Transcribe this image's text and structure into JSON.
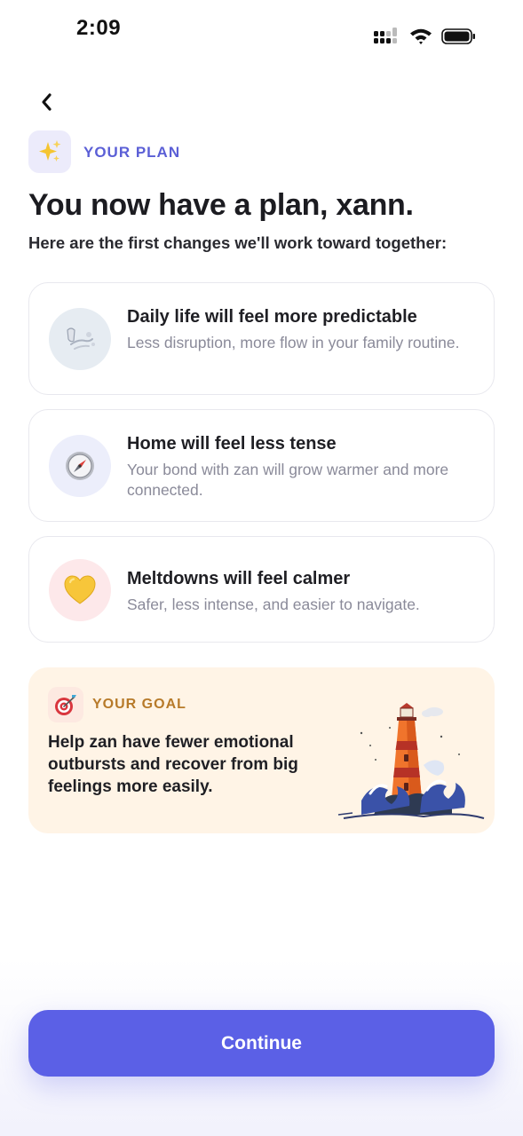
{
  "status_bar": {
    "time": "2:09"
  },
  "header": {
    "back_icon": "chevron-left-icon",
    "plan_icon": "sparkles-icon",
    "plan_tag": "YOUR PLAN",
    "title": "You now have a plan, xann.",
    "subtitle": "Here are the first changes we'll work toward together:"
  },
  "cards": [
    {
      "icon": "wind-icon",
      "icon_bg": "#e6ecf2",
      "title": "Daily life will feel more predictable",
      "description": "Less disruption, more flow in your family routine."
    },
    {
      "icon": "compass-icon",
      "icon_bg": "#eceefb",
      "title": "Home will feel less tense",
      "description": "Your bond with zan will grow warmer and more connected."
    },
    {
      "icon": "yellow-heart-icon",
      "icon_bg": "#fde8ea",
      "title": "Meltdowns will feel calmer",
      "description": "Safer, less intense, and easier to navigate."
    }
  ],
  "goal": {
    "icon": "target-icon",
    "tag": "YOUR GOAL",
    "text": "Help zan have fewer emotional outbursts and recover from big feelings more easily.",
    "illustration": "lighthouse-illustration"
  },
  "footer": {
    "continue_label": "Continue"
  },
  "colors": {
    "accent": "#5b60e6",
    "goal_bg": "#fff4e6",
    "goal_tag": "#b77a2a"
  }
}
